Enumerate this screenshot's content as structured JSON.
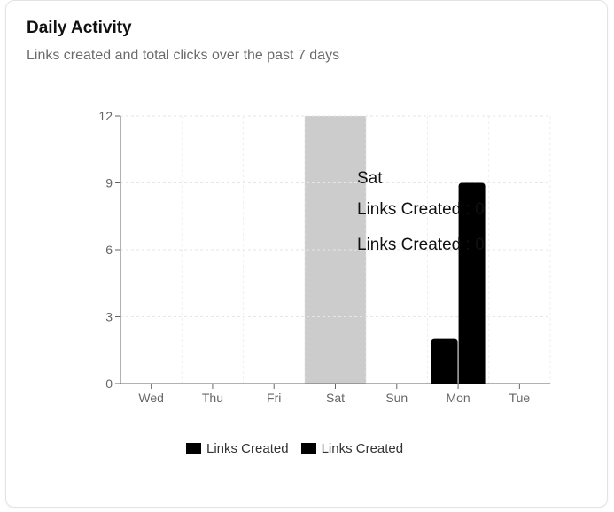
{
  "header": {
    "title": "Daily Activity",
    "subtitle": "Links created and total clicks over the past 7 days"
  },
  "chart_data": {
    "type": "bar",
    "categories": [
      "Wed",
      "Thu",
      "Fri",
      "Sat",
      "Sun",
      "Mon",
      "Tue"
    ],
    "series": [
      {
        "name": "Links Created",
        "values": [
          0,
          0,
          0,
          0,
          0,
          2,
          0
        ],
        "color": "#000000"
      },
      {
        "name": "Links Created",
        "values": [
          0,
          0,
          0,
          0,
          0,
          9,
          0
        ],
        "color": "#000000"
      }
    ],
    "ylim": [
      0,
      12
    ],
    "yticks": [
      0,
      3,
      6,
      9,
      12
    ],
    "grid": true,
    "legend": "bottom",
    "highlight_category": "Sat",
    "highlight_color": "#cccccc",
    "tooltip": {
      "category": "Sat",
      "lines": [
        "Links Created : 0",
        "Links Created : 0"
      ]
    }
  }
}
